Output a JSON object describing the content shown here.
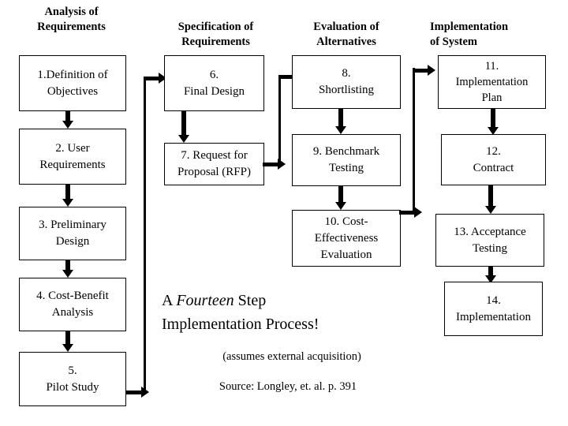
{
  "diagram": {
    "title_caption": {
      "line1_prefix": "A ",
      "line1_emphasis": "Fourteen",
      "line1_suffix": " Step",
      "line2": "Implementation Process!",
      "note": "(assumes external acquisition)",
      "source": "Source: Longley, et. al. p. 391"
    },
    "columns": [
      {
        "header_line1": "Analysis of",
        "header_line2": "Requirements"
      },
      {
        "header_line1": "Specification of",
        "header_line2": "Requirements"
      },
      {
        "header_line1": "Evaluation of",
        "header_line2": "Alternatives"
      },
      {
        "header_line1": "Implementation",
        "header_line2": "of System"
      }
    ],
    "steps": [
      {
        "id": 1,
        "line1": "1.Definition of",
        "line2": "Objectives",
        "line3": ""
      },
      {
        "id": 2,
        "line1": "2. User",
        "line2": "Requirements",
        "line3": ""
      },
      {
        "id": 3,
        "line1": "3. Preliminary",
        "line2": "Design",
        "line3": ""
      },
      {
        "id": 4,
        "line1": "4. Cost-Benefit",
        "line2": "Analysis",
        "line3": ""
      },
      {
        "id": 5,
        "line1": "5.",
        "line2": "Pilot Study",
        "line3": ""
      },
      {
        "id": 6,
        "line1": "6.",
        "line2": "Final Design",
        "line3": ""
      },
      {
        "id": 7,
        "line1": "7. Request for",
        "line2": "Proposal (RFP)",
        "line3": ""
      },
      {
        "id": 8,
        "line1": "8.",
        "line2": "Shortlisting",
        "line3": ""
      },
      {
        "id": 9,
        "line1": "9. Benchmark",
        "line2": "Testing",
        "line3": ""
      },
      {
        "id": 10,
        "line1": "10. Cost-",
        "line2": "Effectiveness",
        "line3": "Evaluation"
      },
      {
        "id": 11,
        "line1": "11.",
        "line2": "Implementation",
        "line3": "Plan"
      },
      {
        "id": 12,
        "line1": "12.",
        "line2": "Contract",
        "line3": ""
      },
      {
        "id": 13,
        "line1": "13. Acceptance",
        "line2": "Testing",
        "line3": ""
      },
      {
        "id": 14,
        "line1": "14.",
        "line2": "Implementation",
        "line3": ""
      }
    ],
    "colors": {
      "line": "#000000",
      "background": "#ffffff",
      "text": "#000000"
    }
  }
}
